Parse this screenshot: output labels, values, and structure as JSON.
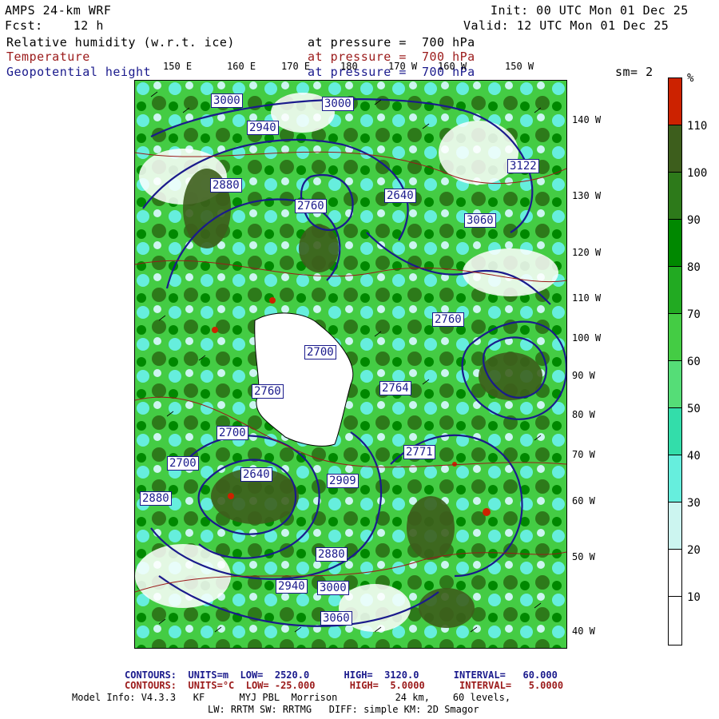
{
  "header": {
    "model": "AMPS 24-km WRF",
    "fcst": "Fcst:    12 h",
    "init": "Init: 00 UTC Mon 01 Dec 25",
    "valid": "Valid: 12 UTC Mon 01 Dec 25"
  },
  "fields": [
    {
      "name": "Relative humidity (w.r.t. ice)",
      "level": "at pressure =  700 hPa",
      "color": "#000000"
    },
    {
      "name": "Temperature",
      "level": "at pressure =  700 hPa",
      "color": "#9b1a1a"
    },
    {
      "name": "Geopotential height",
      "level": "at pressure =  700 hPa",
      "color": "#1a1a8c"
    }
  ],
  "smoothing": "sm= 2",
  "lon_labels": [
    "150 E",
    "160 E",
    "170 E",
    "180",
    "170 W",
    "160 W",
    "150 W"
  ],
  "lat_labels": [
    "140 W",
    "130 W",
    "120 W",
    "110 W",
    "100 W",
    "90 W",
    "80 W",
    "70 W",
    "60 W",
    "50 W",
    "40 W"
  ],
  "colorbar": {
    "unit": "%",
    "labels": [
      "110",
      "100",
      "90",
      "80",
      "70",
      "60",
      "50",
      "40",
      "30",
      "20",
      "10"
    ],
    "colors": [
      "#cc2200",
      "#3d5e1c",
      "#2d7a1a",
      "#008800",
      "#22aa22",
      "#44cc44",
      "#55dd77",
      "#33ddaa",
      "#66eedd",
      "#ccf5f0",
      "#ffffff",
      "#ffffff"
    ]
  },
  "height_labels": [
    "3000",
    "2940",
    "3000",
    "2880",
    "2760",
    "2640",
    "2700",
    "2764",
    "2771",
    "2909",
    "2760",
    "3060",
    "3122",
    "2760",
    "2700",
    "2640",
    "2700",
    "2880",
    "3000",
    "2940",
    "2880",
    "3060"
  ],
  "footer": {
    "contours1": "CONTOURS:  UNITS=m  LOW=  2520.0      HIGH=  3120.0      INTERVAL=   60.000",
    "contours2": "CONTOURS:  UNITS=°C  LOW= -25.000      HIGH=  5.0000      INTERVAL=   5.0000",
    "model_info": "Model Info: V4.3.3   KF      MYJ PBL  Morrison          24 km,    60 levels,",
    "physics": "LW: RRTM SW: RRTMG   DIFF: simple KM: 2D Smagor"
  }
}
